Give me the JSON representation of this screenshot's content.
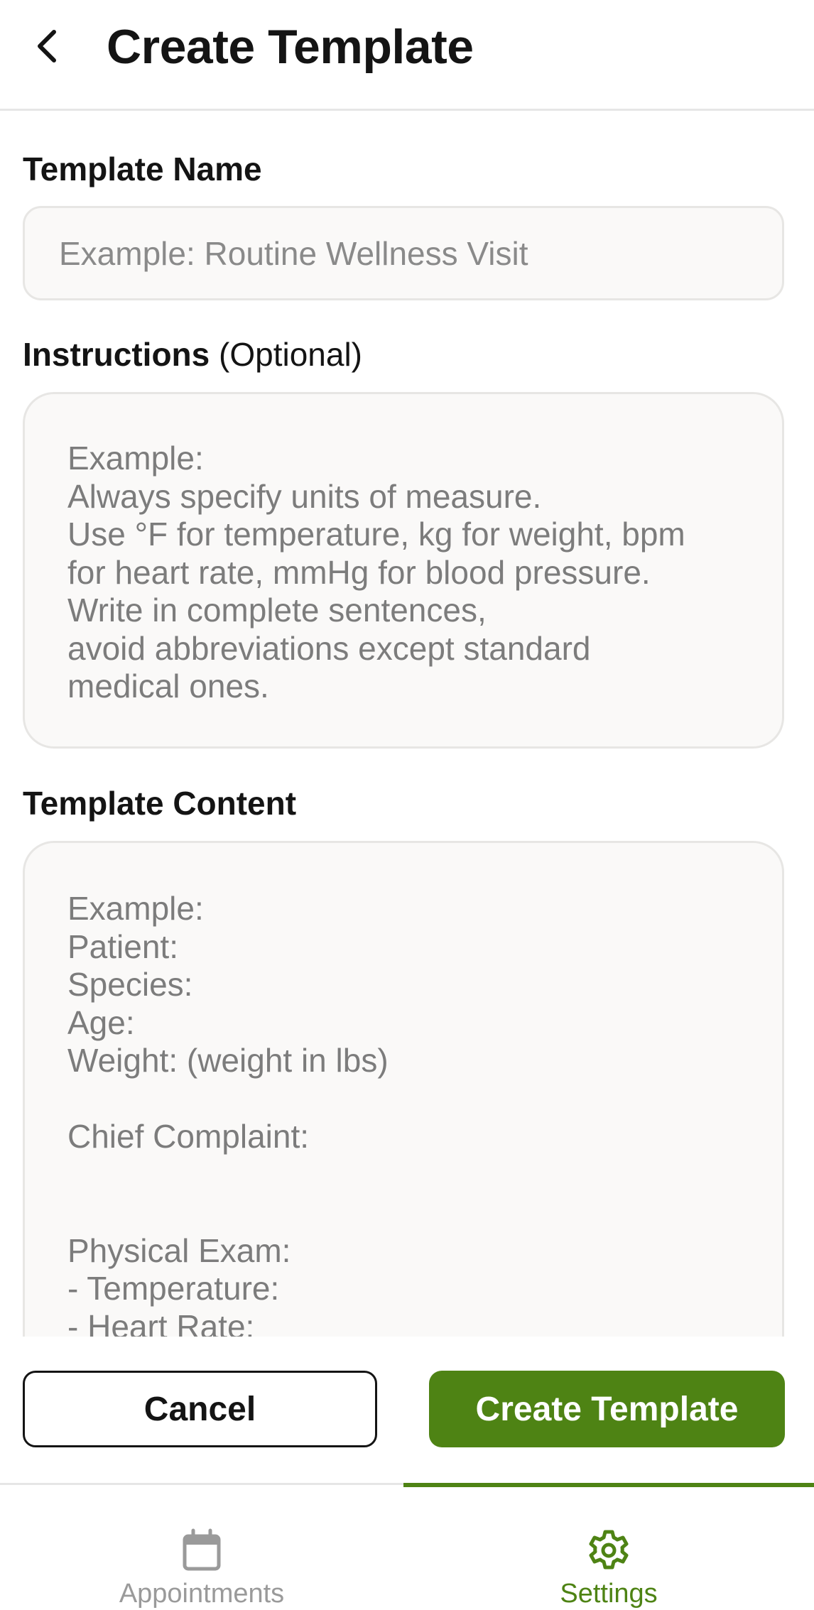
{
  "header": {
    "back_icon": "chevron-left-icon",
    "title": "Create Template"
  },
  "form": {
    "template_name": {
      "label": "Template Name",
      "value": "",
      "placeholder": "Example: Routine Wellness Visit"
    },
    "instructions": {
      "label": "Instructions",
      "optional_note": "(Optional)",
      "placeholder": "Example:\nAlways specify units of measure.\nUse °F for temperature, kg for weight, bpm for heart rate, mmHg for blood pressure.\nWrite in complete sentences,\navoid abbreviations except standard medical ones."
    },
    "template_content": {
      "label": "Template Content",
      "placeholder": "Example:\nPatient:\nSpecies:\nAge:\nWeight: (weight in lbs)\n\nChief Complaint:\n\n\nPhysical Exam:\n- Temperature:\n- Heart Rate:"
    }
  },
  "actions": {
    "cancel_label": "Cancel",
    "create_label": "Create Template"
  },
  "tab_bar": {
    "items": [
      {
        "label": "Appointments",
        "icon": "calendar-icon",
        "active": false
      },
      {
        "label": "Settings",
        "icon": "gear-icon",
        "active": true
      }
    ]
  },
  "colors": {
    "accent": "#4e8314",
    "field_background": "#faf9f8",
    "field_border": "#e7e6e4",
    "placeholder_text": "#7c7c7c",
    "inactive_tab": "#9a9a9a"
  }
}
